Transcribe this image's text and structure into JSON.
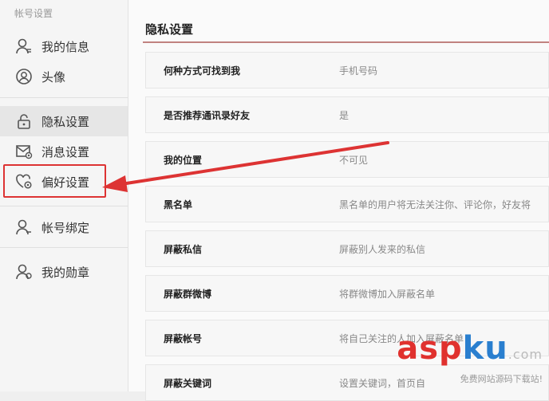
{
  "sidebar": {
    "header": "帐号设置",
    "items": [
      {
        "label": "我的信息",
        "icon": "user-info-icon"
      },
      {
        "label": "头像",
        "icon": "avatar-icon"
      },
      {
        "label": "隐私设置",
        "icon": "lock-icon"
      },
      {
        "label": "消息设置",
        "icon": "message-settings-icon"
      },
      {
        "label": "偏好设置",
        "icon": "preferences-icon"
      },
      {
        "label": "帐号绑定",
        "icon": "account-bind-icon"
      },
      {
        "label": "我的勋章",
        "icon": "medal-icon"
      }
    ]
  },
  "main": {
    "title": "隐私设置",
    "rows": [
      {
        "label": "何种方式可找到我",
        "value": "手机号码"
      },
      {
        "label": "是否推荐通讯录好友",
        "value": "是"
      },
      {
        "label": "我的位置",
        "value": "不可见"
      },
      {
        "label": "黑名单",
        "value": "黑名单的用户将无法关注你、评论你，好友将"
      },
      {
        "label": "屏蔽私信",
        "value": "屏蔽别人发来的私信"
      },
      {
        "label": "屏蔽群微博",
        "value": "将群微博加入屏蔽名单"
      },
      {
        "label": "屏蔽帐号",
        "value": "将自己关注的人加入屏蔽名单"
      },
      {
        "label": "屏蔽关键词",
        "value": "设置关键词，首页自"
      }
    ]
  },
  "watermark": {
    "brand_asp": "asp",
    "brand_ku": "ku",
    "brand_com": ".com",
    "tagline": "免费网站源码下载站!"
  },
  "colors": {
    "accent_red": "#d33333",
    "watermark_asp": "#e0312e",
    "watermark_ku": "#2a7fcf"
  }
}
